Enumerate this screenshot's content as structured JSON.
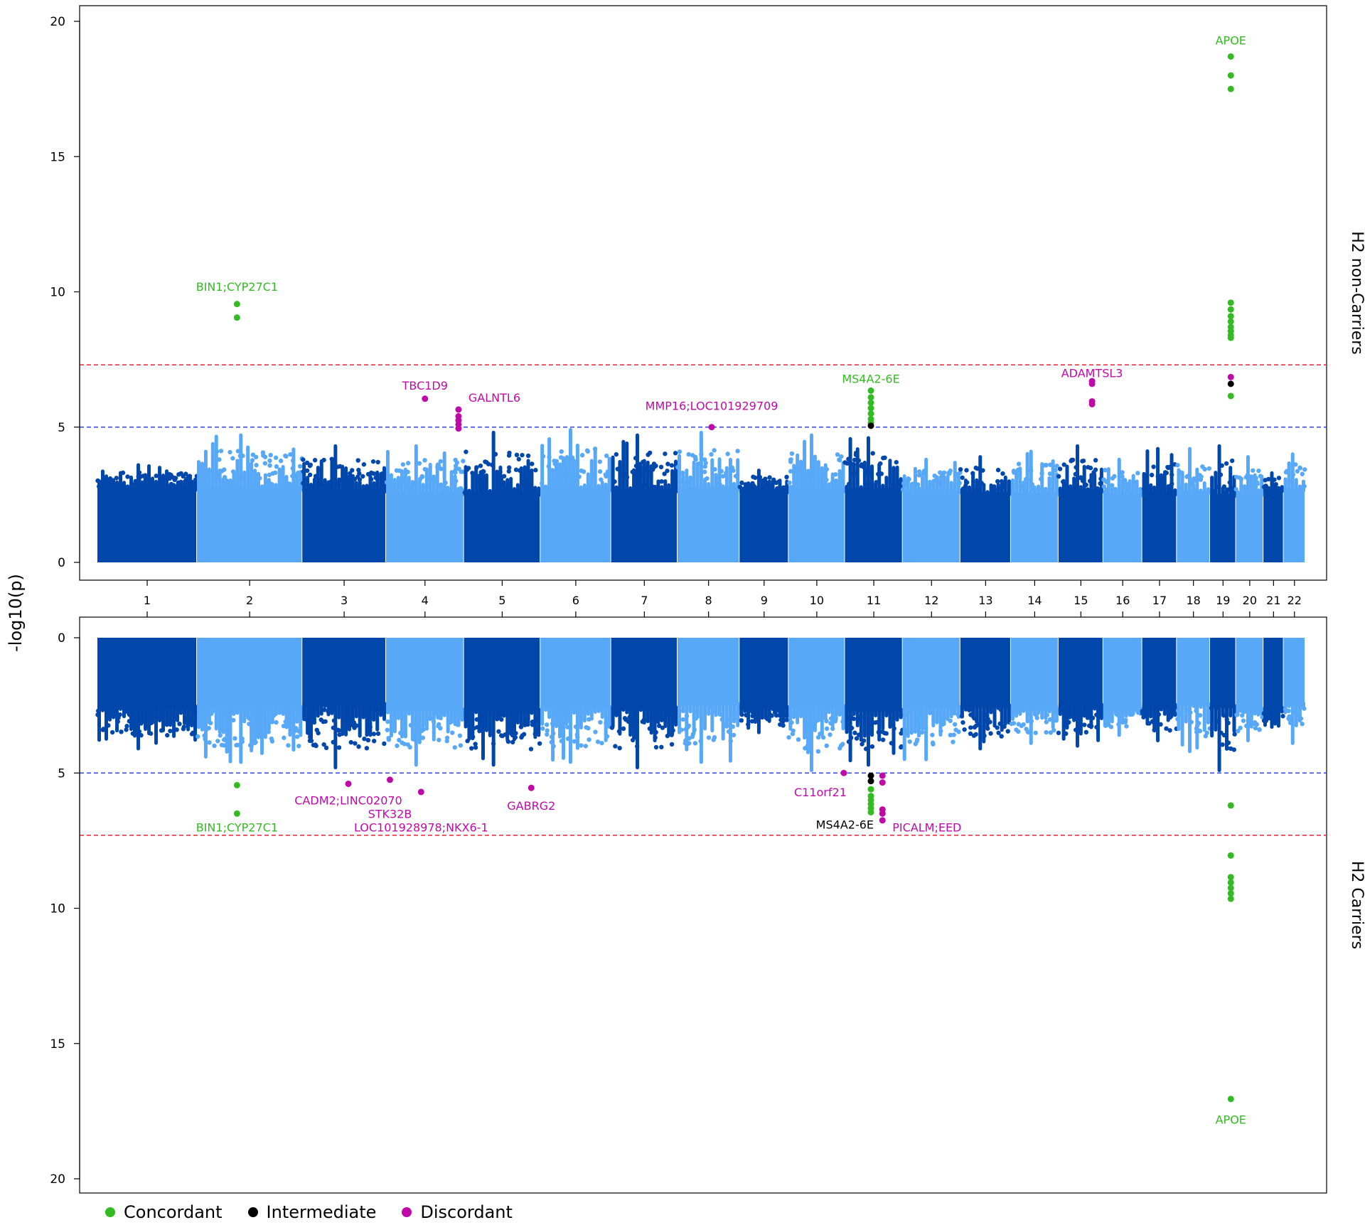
{
  "chart_data": {
    "type": "scatter",
    "subtype": "miami_plot",
    "y_axis_label": "-log10(p)",
    "chromosomes": [
      "1",
      "2",
      "3",
      "4",
      "5",
      "6",
      "7",
      "8",
      "9",
      "10",
      "11",
      "12",
      "13",
      "14",
      "15",
      "16",
      "17",
      "18",
      "19",
      "20",
      "21",
      "22"
    ],
    "chromosome_colors": [
      "#0047ab",
      "#58a8f8"
    ],
    "colors": {
      "concordant": "#33bb22",
      "intermediate": "#000000",
      "discordant": "#c00aa8",
      "suggestive_line": "#3344dd",
      "genomewide_line": "#ee3344",
      "dark_blue": "#0047ab",
      "light_blue": "#58a8f8"
    },
    "legend": [
      {
        "label": "Concordant",
        "color": "#33bb22"
      },
      {
        "label": "Intermediate",
        "color": "#000000"
      },
      {
        "label": "Discordant",
        "color": "#c00aa8"
      }
    ],
    "suggestive_threshold": 5,
    "genomewide_threshold": 7.3,
    "panels": [
      {
        "name": "H2 non-Carriers",
        "ylim": [
          0,
          20
        ],
        "yticks": [
          0,
          5,
          10,
          15,
          20
        ],
        "inverted": false,
        "chrom_peaks": [
          3.6,
          4.7,
          4.3,
          4.3,
          4.8,
          4.9,
          4.7,
          4.8,
          3.4,
          4.7,
          4.6,
          3.8,
          3.9,
          4.1,
          4.3,
          3.8,
          4.2,
          4.2,
          4.3,
          3.9,
          3.3,
          4.0
        ],
        "hits": [
          {
            "chr": "2",
            "pos": 0.38,
            "values": [
              9.55,
              9.05
            ],
            "cat": "concordant"
          },
          {
            "chr": "4",
            "pos": 0.5,
            "values": [
              6.05
            ],
            "cat": "discordant"
          },
          {
            "chr": "4",
            "pos": 0.93,
            "values": [
              5.65,
              5.4,
              5.25,
              5.1,
              4.95
            ],
            "cat": "discordant"
          },
          {
            "chr": "8",
            "pos": 0.55,
            "values": [
              5.0
            ],
            "cat": "discordant"
          },
          {
            "chr": "11",
            "pos": 0.45,
            "values": [
              6.35,
              6.1,
              5.9,
              5.7,
              5.5,
              5.3,
              5.15
            ],
            "cat": "concordant"
          },
          {
            "chr": "11",
            "pos": 0.45,
            "values": [
              5.05
            ],
            "cat": "intermediate"
          },
          {
            "chr": "15",
            "pos": 0.75,
            "values": [
              6.7,
              6.6,
              5.95,
              5.85
            ],
            "cat": "discordant"
          },
          {
            "chr": "19",
            "pos": 0.8,
            "values": [
              18.7,
              18.0,
              17.5,
              9.6,
              9.35,
              9.1,
              8.9,
              8.7,
              8.55,
              8.4,
              8.3,
              6.15
            ],
            "cat": "concordant"
          },
          {
            "chr": "19",
            "pos": 0.8,
            "values": [
              6.85
            ],
            "cat": "discordant"
          },
          {
            "chr": "19",
            "pos": 0.8,
            "values": [
              6.6
            ],
            "cat": "intermediate"
          }
        ],
        "annotations": [
          {
            "label": "BIN1;CYP27C1",
            "chr": "2",
            "pos": 0.38,
            "value": 10.2,
            "cat": "concordant"
          },
          {
            "label": "TBC1D9",
            "chr": "4",
            "pos": 0.5,
            "value": 6.55,
            "cat": "discordant"
          },
          {
            "label": "GALNTL6",
            "chr": "4",
            "pos": 0.93,
            "value": 6.1,
            "cat": "discordant",
            "anchor": "start"
          },
          {
            "label": "MMP16;LOC101929709",
            "chr": "8",
            "pos": 0.55,
            "value": 5.8,
            "cat": "discordant"
          },
          {
            "label": "MS4A2-6E",
            "chr": "11",
            "pos": 0.45,
            "value": 6.8,
            "cat": "concordant"
          },
          {
            "label": "ADAMTSL3",
            "chr": "15",
            "pos": 0.75,
            "value": 7.0,
            "cat": "discordant"
          },
          {
            "label": "APOE",
            "chr": "19",
            "pos": 0.8,
            "value": 19.3,
            "cat": "concordant"
          }
        ],
        "side_label": "H2 non-Carriers"
      },
      {
        "name": "H2 Carriers",
        "ylim": [
          0,
          20
        ],
        "yticks": [
          0,
          5,
          10,
          15,
          20
        ],
        "inverted": true,
        "chrom_peaks": [
          4.1,
          4.6,
          4.8,
          4.7,
          4.7,
          4.6,
          4.8,
          4.6,
          3.5,
          4.9,
          4.7,
          4.5,
          4.1,
          3.9,
          4.0,
          3.6,
          3.8,
          4.2,
          4.9,
          3.8,
          3.3,
          3.9
        ],
        "hits": [
          {
            "chr": "2",
            "pos": 0.38,
            "values": [
              5.45,
              6.5
            ],
            "cat": "concordant"
          },
          {
            "chr": "3",
            "pos": 0.55,
            "values": [
              5.4
            ],
            "cat": "discordant"
          },
          {
            "chr": "4",
            "pos": 0.05,
            "values": [
              5.25
            ],
            "cat": "discordant"
          },
          {
            "chr": "4",
            "pos": 0.45,
            "values": [
              5.7
            ],
            "cat": "discordant"
          },
          {
            "chr": "5",
            "pos": 0.88,
            "values": [
              5.55
            ],
            "cat": "discordant"
          },
          {
            "chr": "10",
            "pos": 0.98,
            "values": [
              5.0
            ],
            "cat": "discordant"
          },
          {
            "chr": "11",
            "pos": 0.45,
            "values": [
              5.6,
              5.85,
              6.0,
              6.15,
              6.3,
              6.45
            ],
            "cat": "concordant"
          },
          {
            "chr": "11",
            "pos": 0.45,
            "values": [
              5.1,
              5.3
            ],
            "cat": "intermediate"
          },
          {
            "chr": "11",
            "pos": 0.65,
            "values": [
              5.1,
              5.35,
              6.35,
              6.5,
              6.75
            ],
            "cat": "discordant"
          },
          {
            "chr": "19",
            "pos": 0.8,
            "values": [
              6.2,
              8.05,
              8.85,
              9.05,
              9.25,
              9.45,
              9.65,
              17.05
            ],
            "cat": "concordant"
          }
        ],
        "annotations": [
          {
            "label": "BIN1;CYP27C1",
            "chr": "2",
            "pos": 0.38,
            "value": 7.0,
            "cat": "concordant"
          },
          {
            "label": "CADM2;LINC02070",
            "chr": "3",
            "pos": 0.55,
            "value": 6.0,
            "cat": "discordant"
          },
          {
            "label": "STK32B",
            "chr": "4",
            "pos": 0.05,
            "value": 6.5,
            "cat": "discordant"
          },
          {
            "label": "LOC101928978;NKX6-1",
            "chr": "4",
            "pos": 0.45,
            "value": 7.0,
            "cat": "discordant"
          },
          {
            "label": "GABRG2",
            "chr": "5",
            "pos": 0.88,
            "value": 6.2,
            "cat": "discordant"
          },
          {
            "label": "C11orf21",
            "chr": "10",
            "pos": 0.98,
            "value": 5.7,
            "cat": "discordant",
            "anchor": "end"
          },
          {
            "label": "MS4A2-6E",
            "chr": "11",
            "pos": 0.45,
            "value": 6.9,
            "cat": "intermediate",
            "anchor": "end"
          },
          {
            "label": "PICALM;EED",
            "chr": "11",
            "pos": 0.65,
            "value": 7.0,
            "cat": "discordant",
            "anchor": "start"
          },
          {
            "label": "APOE",
            "chr": "19",
            "pos": 0.8,
            "value": 17.8,
            "cat": "concordant"
          }
        ],
        "side_label": "H2 Carriers"
      }
    ]
  }
}
